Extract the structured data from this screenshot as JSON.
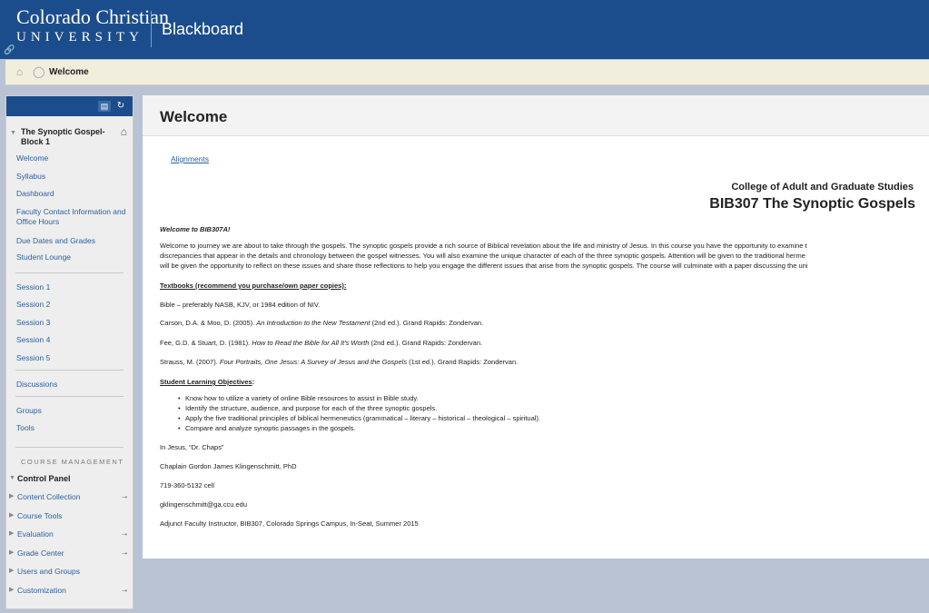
{
  "header": {
    "logo_line1": "Colorado Christian",
    "logo_line2": "UNIVERSITY",
    "app_title": "Blackboard"
  },
  "breadcrumb": {
    "current": "Welcome"
  },
  "sidebar": {
    "course_title": "The Synoptic Gospel-Block 1",
    "group1": [
      "Welcome",
      "Syllabus",
      "Dashboard",
      "Faculty Contact Information and Office Hours",
      "Due Dates and Grades",
      "Student Lounge"
    ],
    "sessions": [
      "Session 1",
      "Session 2",
      "Session 3",
      "Session 4",
      "Session 5"
    ],
    "discussions": "Discussions",
    "group3": [
      "Groups",
      "Tools"
    ],
    "course_management_heading": "COURSE MANAGEMENT",
    "control_panel": "Control Panel",
    "control_items": [
      "Content Collection",
      "Course Tools",
      "Evaluation",
      "Grade Center",
      "Users and Groups",
      "Customization"
    ]
  },
  "main": {
    "page_title": "Welcome",
    "alignments_link": "Alignments",
    "college_heading": "College of Adult and Graduate Studies",
    "course_heading": "BIB307 The Synoptic Gospels",
    "welcome_heading": "Welcome to BIB307A!",
    "intro_lines": [
      "Welcome to journey we are about to take through the gospels.  The synoptic gospels provide a rich source of Biblical revelation about the life and ministry of Jesus.  In this course you have the opportunity to examine t",
      "discrepancies that appear in the details and chronology between the gospel witnesses.  You will also examine the unique character of each of the three synoptic gospels.  Attention will be given to the traditional herme",
      "will be given the opportunity to reflect on these issues and share those reflections to help you engage the different issues that arise from the synoptic gospels.  The course will culminate with a paper discussing the uni"
    ],
    "textbooks_heading": "Textbooks (recommend you purchase/own paper copies):",
    "textbooks": [
      {
        "pre": "Bible – preferably NASB, KJV, or 1984 edition of NIV.",
        "title": "",
        "post": ""
      },
      {
        "pre": "Carson, D.A. & Moo, D. (2005). ",
        "title": "An Introduction to the New Testament",
        "post": " (2nd ed.). Grand Rapids: Zondervan."
      },
      {
        "pre": "Fee, G.D. & Stuart, D. (1981). ",
        "title": "How to Read the Bible for All It's Worth",
        "post": " (2nd ed.).  Grand Rapids: Zondervan."
      },
      {
        "pre": "Strauss, M. (2007). ",
        "title": "Four Portraits, One Jesus: A Survey of Jesus and the Gospels",
        "post": " (1st ed.). Grand Rapids: Zondervan."
      }
    ],
    "objectives_heading": "Student Learning Objectives",
    "objectives_colon": ":",
    "objectives": [
      "Know how to utilize a variety of online Bible resources to assist in Bible study.",
      "Identify the structure, audience, and purpose for each of the three synoptic gospels.",
      "Apply the five traditional principles of biblical hermeneutics (grammatical – literary – historical – theological – spiritual).",
      "Compare and analyze synoptic passages in the gospels."
    ],
    "signoff": "In Jesus, “Dr. Chaps”",
    "contact": {
      "name": "Chaplain Gordon James Klingenschmitt, PhD",
      "phone": "719-360-5132 cell",
      "email": "gklingenschmitt@ga.ccu.edu",
      "role": "Adjunct Faculty Instructor, BIB307, Colorado Springs Campus, In-Seat, Summer 2015"
    }
  }
}
